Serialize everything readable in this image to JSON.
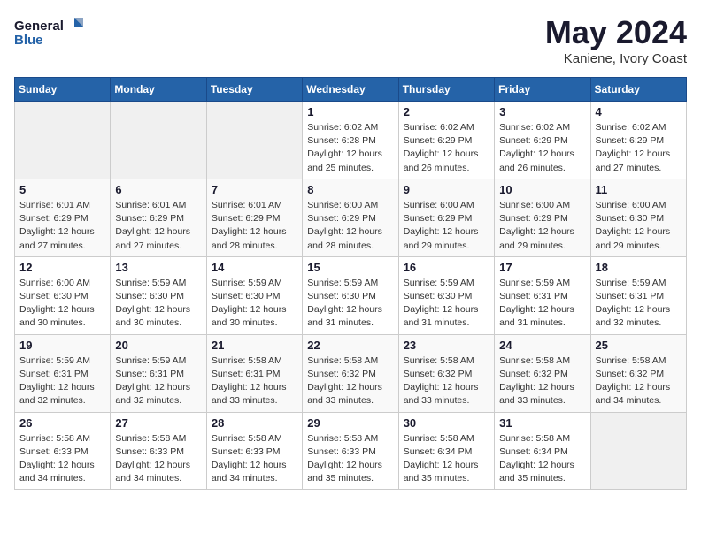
{
  "header": {
    "logo_line1": "General",
    "logo_line2": "Blue",
    "month": "May 2024",
    "location": "Kaniene, Ivory Coast"
  },
  "weekdays": [
    "Sunday",
    "Monday",
    "Tuesday",
    "Wednesday",
    "Thursday",
    "Friday",
    "Saturday"
  ],
  "weeks": [
    [
      {
        "day": "",
        "info": ""
      },
      {
        "day": "",
        "info": ""
      },
      {
        "day": "",
        "info": ""
      },
      {
        "day": "1",
        "info": "Sunrise: 6:02 AM\nSunset: 6:28 PM\nDaylight: 12 hours\nand 25 minutes."
      },
      {
        "day": "2",
        "info": "Sunrise: 6:02 AM\nSunset: 6:29 PM\nDaylight: 12 hours\nand 26 minutes."
      },
      {
        "day": "3",
        "info": "Sunrise: 6:02 AM\nSunset: 6:29 PM\nDaylight: 12 hours\nand 26 minutes."
      },
      {
        "day": "4",
        "info": "Sunrise: 6:02 AM\nSunset: 6:29 PM\nDaylight: 12 hours\nand 27 minutes."
      }
    ],
    [
      {
        "day": "5",
        "info": "Sunrise: 6:01 AM\nSunset: 6:29 PM\nDaylight: 12 hours\nand 27 minutes."
      },
      {
        "day": "6",
        "info": "Sunrise: 6:01 AM\nSunset: 6:29 PM\nDaylight: 12 hours\nand 27 minutes."
      },
      {
        "day": "7",
        "info": "Sunrise: 6:01 AM\nSunset: 6:29 PM\nDaylight: 12 hours\nand 28 minutes."
      },
      {
        "day": "8",
        "info": "Sunrise: 6:00 AM\nSunset: 6:29 PM\nDaylight: 12 hours\nand 28 minutes."
      },
      {
        "day": "9",
        "info": "Sunrise: 6:00 AM\nSunset: 6:29 PM\nDaylight: 12 hours\nand 29 minutes."
      },
      {
        "day": "10",
        "info": "Sunrise: 6:00 AM\nSunset: 6:29 PM\nDaylight: 12 hours\nand 29 minutes."
      },
      {
        "day": "11",
        "info": "Sunrise: 6:00 AM\nSunset: 6:30 PM\nDaylight: 12 hours\nand 29 minutes."
      }
    ],
    [
      {
        "day": "12",
        "info": "Sunrise: 6:00 AM\nSunset: 6:30 PM\nDaylight: 12 hours\nand 30 minutes."
      },
      {
        "day": "13",
        "info": "Sunrise: 5:59 AM\nSunset: 6:30 PM\nDaylight: 12 hours\nand 30 minutes."
      },
      {
        "day": "14",
        "info": "Sunrise: 5:59 AM\nSunset: 6:30 PM\nDaylight: 12 hours\nand 30 minutes."
      },
      {
        "day": "15",
        "info": "Sunrise: 5:59 AM\nSunset: 6:30 PM\nDaylight: 12 hours\nand 31 minutes."
      },
      {
        "day": "16",
        "info": "Sunrise: 5:59 AM\nSunset: 6:30 PM\nDaylight: 12 hours\nand 31 minutes."
      },
      {
        "day": "17",
        "info": "Sunrise: 5:59 AM\nSunset: 6:31 PM\nDaylight: 12 hours\nand 31 minutes."
      },
      {
        "day": "18",
        "info": "Sunrise: 5:59 AM\nSunset: 6:31 PM\nDaylight: 12 hours\nand 32 minutes."
      }
    ],
    [
      {
        "day": "19",
        "info": "Sunrise: 5:59 AM\nSunset: 6:31 PM\nDaylight: 12 hours\nand 32 minutes."
      },
      {
        "day": "20",
        "info": "Sunrise: 5:59 AM\nSunset: 6:31 PM\nDaylight: 12 hours\nand 32 minutes."
      },
      {
        "day": "21",
        "info": "Sunrise: 5:58 AM\nSunset: 6:31 PM\nDaylight: 12 hours\nand 33 minutes."
      },
      {
        "day": "22",
        "info": "Sunrise: 5:58 AM\nSunset: 6:32 PM\nDaylight: 12 hours\nand 33 minutes."
      },
      {
        "day": "23",
        "info": "Sunrise: 5:58 AM\nSunset: 6:32 PM\nDaylight: 12 hours\nand 33 minutes."
      },
      {
        "day": "24",
        "info": "Sunrise: 5:58 AM\nSunset: 6:32 PM\nDaylight: 12 hours\nand 33 minutes."
      },
      {
        "day": "25",
        "info": "Sunrise: 5:58 AM\nSunset: 6:32 PM\nDaylight: 12 hours\nand 34 minutes."
      }
    ],
    [
      {
        "day": "26",
        "info": "Sunrise: 5:58 AM\nSunset: 6:33 PM\nDaylight: 12 hours\nand 34 minutes."
      },
      {
        "day": "27",
        "info": "Sunrise: 5:58 AM\nSunset: 6:33 PM\nDaylight: 12 hours\nand 34 minutes."
      },
      {
        "day": "28",
        "info": "Sunrise: 5:58 AM\nSunset: 6:33 PM\nDaylight: 12 hours\nand 34 minutes."
      },
      {
        "day": "29",
        "info": "Sunrise: 5:58 AM\nSunset: 6:33 PM\nDaylight: 12 hours\nand 35 minutes."
      },
      {
        "day": "30",
        "info": "Sunrise: 5:58 AM\nSunset: 6:34 PM\nDaylight: 12 hours\nand 35 minutes."
      },
      {
        "day": "31",
        "info": "Sunrise: 5:58 AM\nSunset: 6:34 PM\nDaylight: 12 hours\nand 35 minutes."
      },
      {
        "day": "",
        "info": ""
      }
    ]
  ]
}
